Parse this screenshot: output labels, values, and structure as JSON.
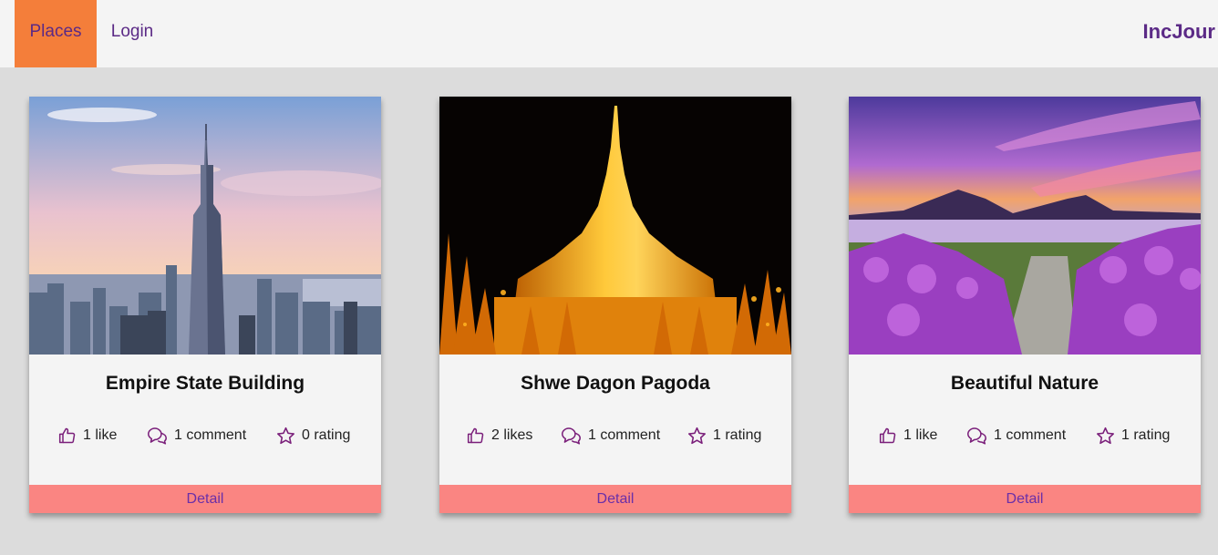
{
  "nav": {
    "places_label": "Places",
    "login_label": "Login",
    "brand": "IncJour",
    "active_color": "#f47e3a",
    "text_color": "#5b2a86"
  },
  "cards": [
    {
      "title": "Empire State Building",
      "likes": "1 like",
      "comments": "1 comment",
      "rating": "0 rating",
      "detail_label": "Detail",
      "image": "empire-state-building-photo"
    },
    {
      "title": "Shwe Dagon Pagoda",
      "likes": "2 likes",
      "comments": "1 comment",
      "rating": "1 rating",
      "detail_label": "Detail",
      "image": "shwe-dagon-pagoda-photo"
    },
    {
      "title": "Beautiful Nature",
      "likes": "1 like",
      "comments": "1 comment",
      "rating": "1 rating",
      "detail_label": "Detail",
      "image": "lake-and-flowers-photo"
    }
  ],
  "colors": {
    "detail_bar": "#fa8582",
    "icon": "#7a1f7a",
    "page_bg": "#dcdcdc"
  },
  "icons": {
    "like": "thumbs-up-icon",
    "comment": "comment-bubbles-icon",
    "rating": "star-icon"
  }
}
